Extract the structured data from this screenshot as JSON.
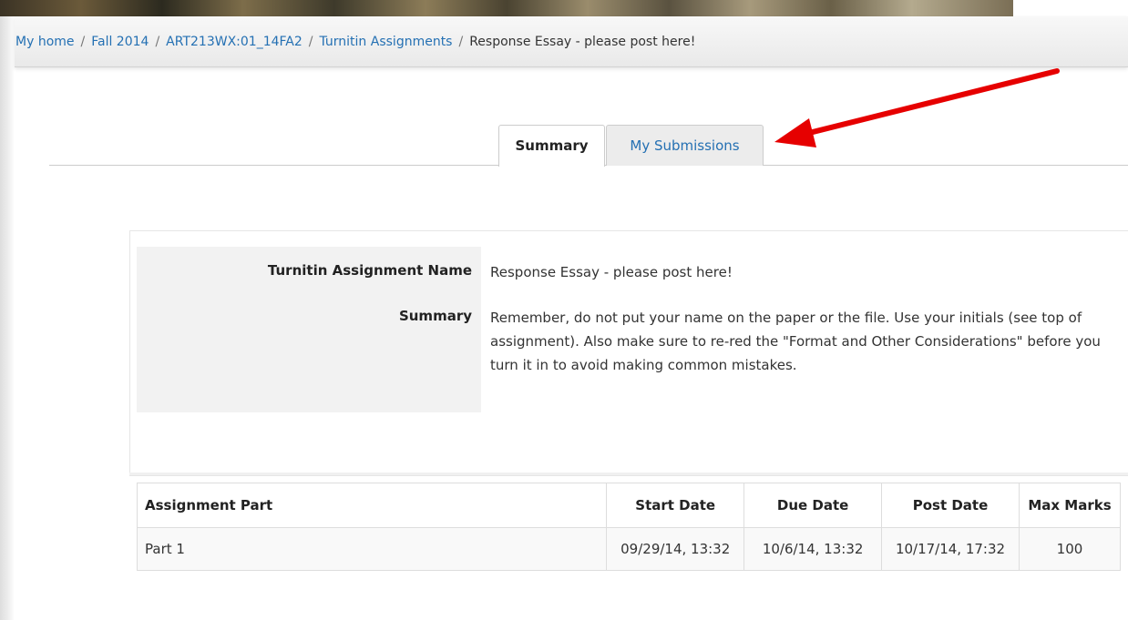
{
  "breadcrumb": {
    "items": [
      "My home",
      "Fall 2014",
      "ART213WX:01_14FA2",
      "Turnitin Assignments"
    ],
    "current": "Response Essay - please post here!",
    "separator": "/"
  },
  "tabs": [
    {
      "label": "Summary",
      "active": true
    },
    {
      "label": "My Submissions",
      "active": false
    }
  ],
  "assignment": {
    "name_label": "Turnitin Assignment Name",
    "name_value": "Response Essay - please post here!",
    "summary_label": "Summary",
    "summary_value": "Remember, do not put your name on the paper or the file.  Use your initials (see top of assignment).  Also make sure to re-red the \"Format and Other Considerations\" before you turn it in to avoid making common mistakes."
  },
  "parts_table": {
    "headers": [
      "Assignment Part",
      "Start Date",
      "Due Date",
      "Post Date",
      "Max Marks"
    ],
    "rows": [
      [
        "Part 1",
        "09/29/14, 13:32",
        "10/6/14, 13:32",
        "10/17/14, 17:32",
        "100"
      ]
    ]
  },
  "colors": {
    "link": "#2470b3",
    "arrow": "#e60000"
  }
}
